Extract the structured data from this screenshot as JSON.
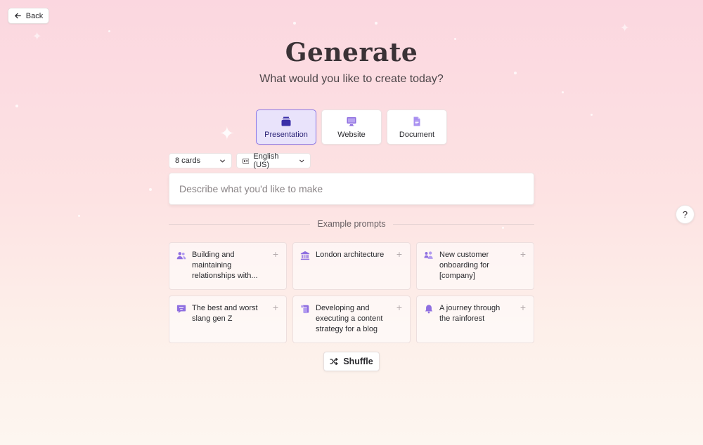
{
  "header": {
    "back_label": "Back"
  },
  "hero": {
    "title": "Generate",
    "subtitle": "What would you like to create today?"
  },
  "types": [
    {
      "label": "Presentation",
      "icon": "presentation-icon",
      "active": true
    },
    {
      "label": "Website",
      "icon": "monitor-icon",
      "active": false
    },
    {
      "label": "Document",
      "icon": "document-icon",
      "active": false
    }
  ],
  "options": {
    "cards": "8 cards",
    "language": "English (US)"
  },
  "prompt": {
    "placeholder": "Describe what you'd like to make"
  },
  "examples": {
    "label": "Example prompts",
    "items": [
      {
        "text": "Building and maintaining relationships with...",
        "icon": "people-icon"
      },
      {
        "text": "London architecture",
        "icon": "bank-icon"
      },
      {
        "text": "New customer onboarding for [company]",
        "icon": "users-group-icon"
      },
      {
        "text": "The best and worst slang gen Z",
        "icon": "chat-icon"
      },
      {
        "text": "Developing and executing a content strategy for a blog o...",
        "icon": "scroll-icon"
      },
      {
        "text": "A journey through the rainforest",
        "icon": "bell-icon"
      }
    ],
    "add_glyph": "+"
  },
  "shuffle_label": "Shuffle",
  "help_label": "?",
  "colors": {
    "accent": "#8a76e6",
    "icon_purple": "#8f6fe0",
    "active_bg": "#e9e3fb"
  }
}
